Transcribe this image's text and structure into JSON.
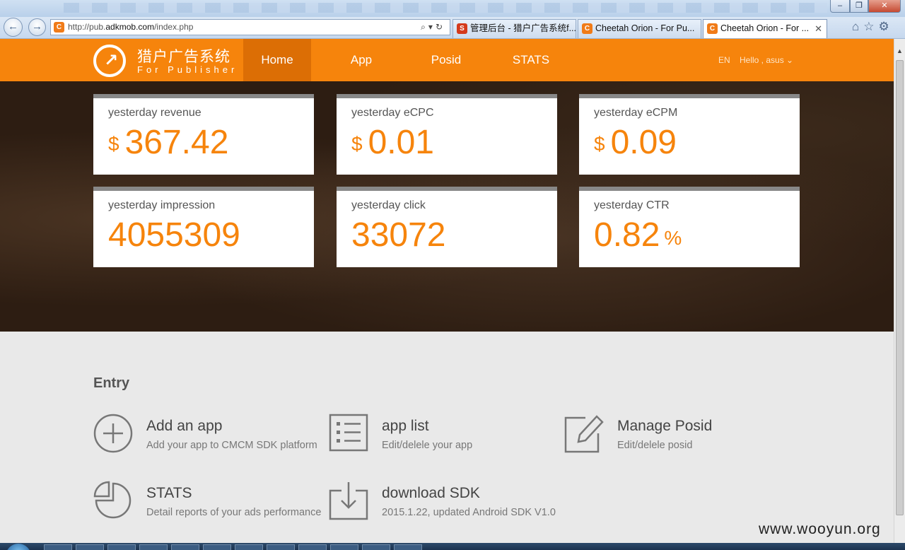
{
  "browser": {
    "address_url_prefix": "http://pub.",
    "address_url_domain": "adkmob.com",
    "address_url_path": "/index.php",
    "tabs": [
      {
        "label": "管理后台 - 猎户广告系统f..."
      },
      {
        "label": "Cheetah Orion - For Pu..."
      },
      {
        "label": "Cheetah Orion - For ..."
      }
    ]
  },
  "header": {
    "logo_cn": "猎户广告系统",
    "logo_en": "For Publisher",
    "nav": [
      "Home",
      "App",
      "Posid",
      "STATS"
    ],
    "lang": "EN",
    "greeting": "Hello , asus"
  },
  "stats": [
    {
      "label": "yesterday revenue",
      "currency": "$",
      "value": "367.42"
    },
    {
      "label": "yesterday eCPC",
      "currency": "$",
      "value": "0.01"
    },
    {
      "label": "yesterday eCPM",
      "currency": "$",
      "value": "0.09"
    },
    {
      "label": "yesterday impression",
      "value": "4055309"
    },
    {
      "label": "yesterday click",
      "value": "33072"
    },
    {
      "label": "yesterday CTR",
      "value": "0.82",
      "unit": "%"
    }
  ],
  "entry": {
    "title": "Entry",
    "items": [
      {
        "title": "Add an app",
        "desc": "Add your app to CMCM SDK platform"
      },
      {
        "title": "app list",
        "desc": "Edit/delele your app"
      },
      {
        "title": "Manage Posid",
        "desc": "Edit/delele posid"
      },
      {
        "title": "STATS",
        "desc": "Detail reports of your ads performance"
      },
      {
        "title": "download SDK",
        "desc": "2015.1.22, updated Android SDK V1.0"
      }
    ]
  },
  "watermark": "www.wooyun.org",
  "colors": {
    "brand_orange": "#f6840c",
    "nav_active": "#dc6e05",
    "hero_bg": "#2d1d12",
    "page_bg": "#e9e9e9"
  }
}
